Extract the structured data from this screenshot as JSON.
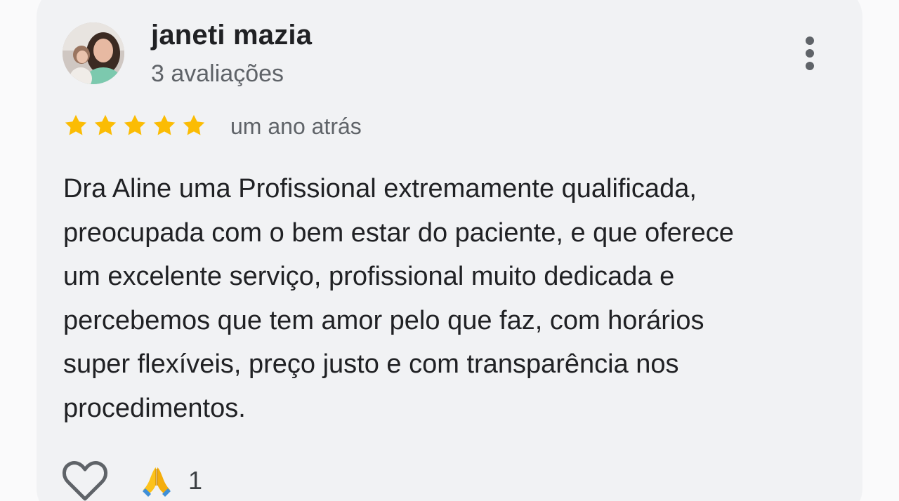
{
  "review": {
    "reviewer_name": "janeti mazia",
    "review_count": "3 avaliações",
    "rating": 5,
    "rating_max": 5,
    "time_ago": "um ano atrás",
    "text_lines": [
      "Dra Aline uma Profissional extremamente qualificada,",
      "preocupada com o bem estar do paciente, e que oferece",
      "um excelente serviço, profissional muito dedicada e",
      "percebemos que tem amor pelo que faz, com horários",
      "super flexíveis, preço justo e com transparência nos",
      "procedimentos."
    ]
  },
  "actions": {
    "like_icon": "heart-outline-icon",
    "reaction_icon": "folded-hands-emoji",
    "reaction_count": "1",
    "more_icon": "more-vertical-icon"
  },
  "colors": {
    "card_background": "#f1f2f4",
    "star": "#fbbc04",
    "primary_text": "#202124",
    "secondary_text": "#5f6368"
  }
}
